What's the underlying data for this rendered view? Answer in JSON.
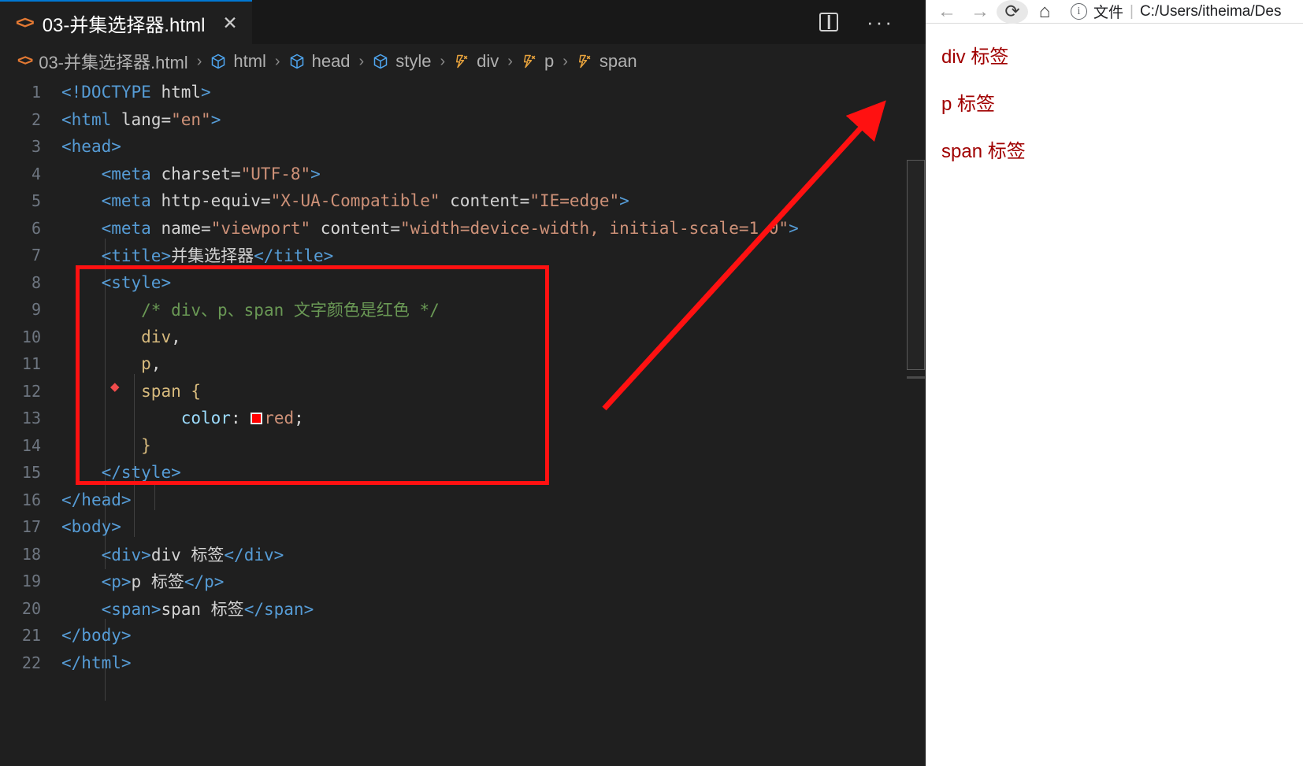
{
  "editor": {
    "tab": {
      "title": "03-并集选择器.html",
      "close_label": "✕",
      "file_icon": "code-file-icon"
    },
    "actions": {
      "split_editor": "split-editor-icon",
      "more": "···"
    },
    "breadcrumb": [
      {
        "label": "03-并集选择器.html",
        "icon": "code-file-icon"
      },
      {
        "label": "html",
        "icon": "symbol-cube-icon"
      },
      {
        "label": "head",
        "icon": "symbol-cube-icon"
      },
      {
        "label": "style",
        "icon": "symbol-cube-icon"
      },
      {
        "label": "div",
        "icon": "symbol-selector-icon"
      },
      {
        "label": "p",
        "icon": "symbol-selector-icon"
      },
      {
        "label": "span",
        "icon": "symbol-selector-icon"
      }
    ],
    "separator": "›",
    "line_numbers": [
      "1",
      "2",
      "3",
      "4",
      "5",
      "6",
      "7",
      "8",
      "9",
      "10",
      "11",
      "12",
      "13",
      "14",
      "15",
      "16",
      "17",
      "18",
      "19",
      "20",
      "21",
      "22"
    ],
    "code_lines": [
      "<!DOCTYPE html>",
      "<html lang=\"en\">",
      "<head>",
      "    <meta charset=\"UTF-8\">",
      "    <meta http-equiv=\"X-UA-Compatible\" content=\"IE=edge\">",
      "    <meta name=\"viewport\" content=\"width=device-width, initial-scale=1.0\">",
      "    <title>并集选择器</title>",
      "    <style>",
      "        /* div、p、span 文字颜色是红色 */",
      "        div,",
      "        p,",
      "        span {",
      "            color: red;",
      "        }",
      "    </style>",
      "</head>",
      "<body>",
      "    <div>div 标签</div>",
      "    <p>p 标签</p>",
      "    <span>span 标签</span>",
      "</body>",
      "</html>"
    ],
    "colors": {
      "tag": "#569cd6",
      "attribute": "#9cdcfe",
      "string": "#ce9178",
      "comment": "#6a9955",
      "selector": "#d7ba7d",
      "swatch": "#ff0000",
      "annotation": "#ff1111",
      "background": "#1f1f1f"
    }
  },
  "annotation": {
    "highlight_box": "style-block-highlight",
    "arrow": "red-arrow-to-span-output"
  },
  "browser": {
    "toolbar": {
      "back": "←",
      "forward": "→",
      "reload": "⟳",
      "home": "⌂",
      "info": "ⓘ",
      "scheme_label": "文件",
      "divider": "|",
      "url": "C:/Users/itheima/Des"
    },
    "page": {
      "lines": [
        "div 标签",
        "p 标签",
        "span 标签"
      ],
      "text_color": "#a00000"
    }
  }
}
